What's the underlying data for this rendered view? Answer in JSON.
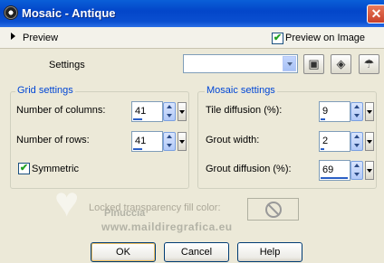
{
  "window": {
    "title": "Mosaic - Antique",
    "close_glyph": "✕"
  },
  "preview": {
    "label": "Preview",
    "on_image_label": "Preview on Image",
    "on_image_checked": true
  },
  "settings": {
    "label": "Settings",
    "preset_value": ""
  },
  "grid": {
    "title": "Grid settings",
    "columns_label": "Number of columns:",
    "columns_value": "41",
    "rows_label": "Number of rows:",
    "rows_value": "41",
    "symmetric_label": "Symmetric",
    "symmetric_checked": true
  },
  "mosaic": {
    "title": "Mosaic settings",
    "tile_label": "Tile diffusion (%):",
    "tile_value": "9",
    "grout_width_label": "Grout width:",
    "grout_width_value": "2",
    "grout_diff_label": "Grout diffusion (%):",
    "grout_diff_value": "69"
  },
  "lock": {
    "label": "Locked transparency fill color:"
  },
  "watermark": {
    "name": "Pinuccia",
    "site": "www.maildiregrafica.eu"
  },
  "buttons": {
    "ok": "OK",
    "cancel": "Cancel",
    "help": "Help"
  },
  "icons": [
    "app-icon",
    "close-icon",
    "save-icon",
    "reset-icon",
    "randomize-icon",
    "no-color-icon"
  ],
  "colors": {
    "titlebar": "#0346c9",
    "group_title": "#0046d5",
    "check": "#21a121"
  }
}
